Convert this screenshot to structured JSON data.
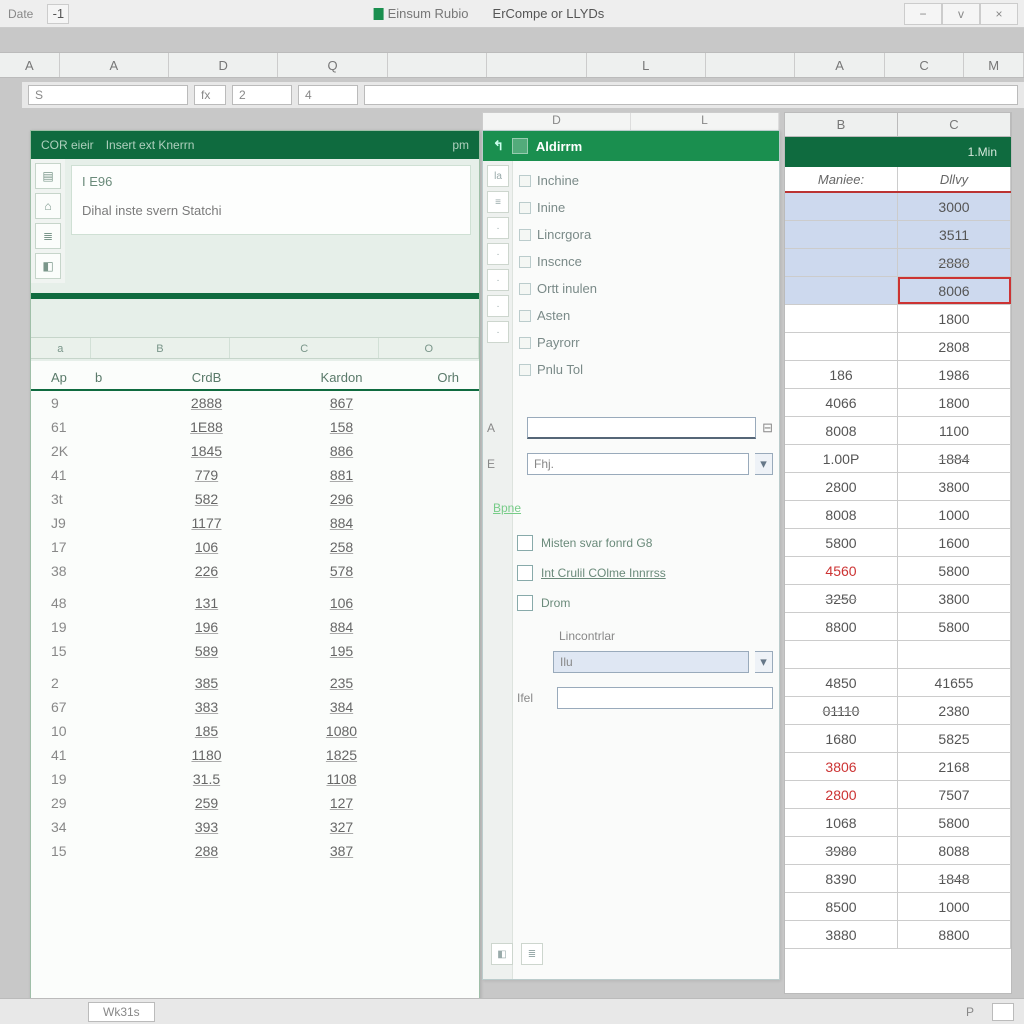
{
  "titlebar": {
    "left_label": "Date",
    "center_brand": "Einsum Rubio",
    "center_sub": "ErCompe or LLYDs",
    "min": "−",
    "max": "v",
    "close": "×"
  },
  "col_letters_top": [
    "A",
    "A",
    "D",
    "Q",
    "",
    "",
    "L",
    "",
    "A",
    "C",
    "M"
  ],
  "formula_bar": {
    "name_box": "S",
    "fx": "fx",
    "slot1": "2",
    "slot2": "4"
  },
  "left_panel": {
    "header_tabs": [
      "COR eieir",
      "Insert ext Knerrn",
      "pm"
    ],
    "box_line1": "I E96",
    "box_line2": "Dihal inste svern Statchi",
    "mini_cols": [
      "a",
      "B",
      "C",
      "O"
    ],
    "table_headers": {
      "idx": "Ap",
      "b": "b",
      "c": "CrdB",
      "d": "Kardon",
      "e": "Orh"
    },
    "rows": [
      {
        "idx": "9",
        "b": "",
        "c": "2888",
        "d": "867"
      },
      {
        "idx": "61",
        "b": "",
        "c": "1E88",
        "d": "158"
      },
      {
        "idx": "2K",
        "b": "",
        "c": "1845",
        "d": "886"
      },
      {
        "idx": "41",
        "b": "",
        "c": "779",
        "d": "881"
      },
      {
        "idx": "3t",
        "b": "",
        "c": "582",
        "d": "296"
      },
      {
        "idx": "J9",
        "b": "",
        "c": "1177",
        "d": "884"
      },
      {
        "idx": "17",
        "b": "",
        "c": "106",
        "d": "258"
      },
      {
        "idx": "38",
        "b": "",
        "c": "226",
        "d": "578"
      },
      {
        "idx": "",
        "b": "",
        "c": "",
        "d": ""
      },
      {
        "idx": "48",
        "b": "",
        "c": "131",
        "d": "106"
      },
      {
        "idx": "19",
        "b": "",
        "c": "196",
        "d": "884"
      },
      {
        "idx": "15",
        "b": "",
        "c": "589",
        "d": "195"
      },
      {
        "idx": "",
        "b": "",
        "c": "",
        "d": ""
      },
      {
        "idx": "2",
        "b": "",
        "c": "385",
        "d": "235"
      },
      {
        "idx": "67",
        "b": "",
        "c": "383",
        "d": "384"
      },
      {
        "idx": "10",
        "b": "",
        "c": "185",
        "d": "1080"
      },
      {
        "idx": "41",
        "b": "",
        "c": "1180",
        "d": "1825"
      },
      {
        "idx": "19",
        "b": "",
        "c": "31.5",
        "d": "1108"
      },
      {
        "idx": "29",
        "b": "",
        "c": "259",
        "d": "127"
      },
      {
        "idx": "34",
        "b": "",
        "c": "393",
        "d": "327"
      },
      {
        "idx": "15",
        "b": "",
        "c": "288",
        "d": "387"
      }
    ]
  },
  "mid_col_letters": [
    "D",
    "L"
  ],
  "mid_panel": {
    "title": "Aldirrm",
    "list_items": [
      "Inchine",
      "Inine",
      "Lincrgora",
      "Inscnce",
      "Ortt inulen",
      "Asten",
      "Payrorr",
      "Pnlu Tol"
    ],
    "field_A_label": "A",
    "field_A_value": "",
    "field_F_label": "E",
    "field_F_hint": "Fhj.",
    "section_label": "Bpne",
    "opt1": "Misten svar fonrd G8",
    "opt2": "Int Crulil COlme Innrrss",
    "sub_label": "Drom",
    "sub_drop_label": "Lincontrlar",
    "sub_drop_value": "Ilu",
    "sub_field2_label": "Ifel",
    "sub_field2_value": ""
  },
  "right_grid": {
    "col_letters": [
      "B",
      "C"
    ],
    "green_label": "1.Min",
    "sub_headers": [
      "Maniee:",
      "Dllvy"
    ],
    "rows": [
      {
        "b": "",
        "c": "3000",
        "sel": true,
        "empty_b": true
      },
      {
        "b": "",
        "c": "3511",
        "sel": true,
        "empty_b": true
      },
      {
        "b": "",
        "c": "2880",
        "sel": true,
        "empty_b": true,
        "strike_c": true
      },
      {
        "b": "",
        "c": "8006",
        "sel": true,
        "empty_b": true,
        "redborder_c": true
      },
      {
        "b": "",
        "c": "1800",
        "empty_b": true
      },
      {
        "b": "",
        "c": "2808",
        "empty_b": true
      },
      {
        "b": "186",
        "c": "1986"
      },
      {
        "b": "4066",
        "c": "1800"
      },
      {
        "b": "8008",
        "c": "1100"
      },
      {
        "b": "1.00P",
        "c": "1884",
        "strike_c": true
      },
      {
        "b": "2800",
        "c": "3800"
      },
      {
        "b": "8008",
        "c": "1000"
      },
      {
        "b": "5800",
        "c": "1600"
      },
      {
        "b": "4560",
        "c": "5800",
        "red_b": true
      },
      {
        "b": "3250",
        "c": "3800",
        "strike_b": true
      },
      {
        "b": "8800",
        "c": "5800"
      },
      {
        "b": "",
        "c": ""
      },
      {
        "b": "4850",
        "c": "41655"
      },
      {
        "b": "01110",
        "c": "2380",
        "strike_b": true
      },
      {
        "b": "1680",
        "c": "5825"
      },
      {
        "b": "3806",
        "c": "2168",
        "red_b": true
      },
      {
        "b": "2800",
        "c": "7507",
        "red_b": true
      },
      {
        "b": "1068",
        "c": "5800"
      },
      {
        "b": "3980",
        "c": "8088",
        "strike_b": true
      },
      {
        "b": "8390",
        "c": "1848",
        "strike_c": true
      },
      {
        "b": "8500",
        "c": "1000"
      },
      {
        "b": "3880",
        "c": "8800"
      }
    ]
  },
  "statusbar": {
    "sheet_tab": "Wk31s",
    "right_label": "P"
  }
}
